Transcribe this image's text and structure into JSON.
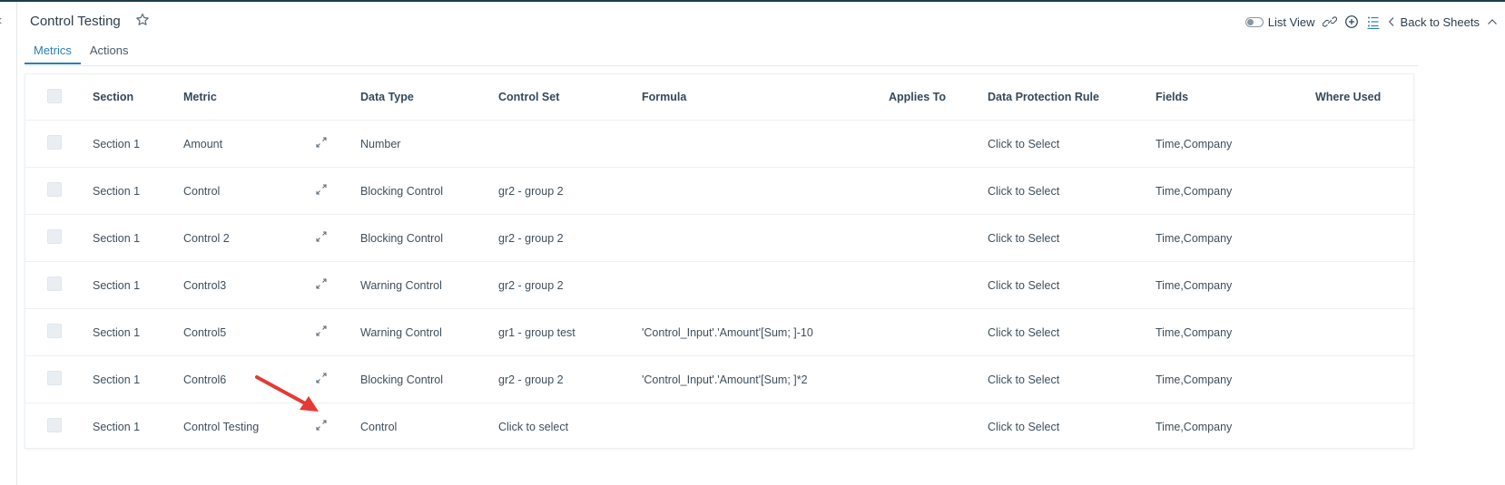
{
  "header": {
    "title": "Control Testing",
    "list_view_label": "List View",
    "back_label": "Back to Sheets"
  },
  "tabs": [
    {
      "label": "Metrics",
      "active": true
    },
    {
      "label": "Actions",
      "active": false
    }
  ],
  "table": {
    "columns": [
      "Section",
      "Metric",
      "",
      "Data Type",
      "Control Set",
      "Formula",
      "Applies To",
      "Data Protection Rule",
      "Fields",
      "Where Used"
    ],
    "rows": [
      {
        "section": "Section 1",
        "metric": "Amount",
        "data_type": "Number",
        "control_set": "",
        "formula": "",
        "applies_to": "",
        "dpr": "Click to Select",
        "fields": "Time,Company",
        "where_used": ""
      },
      {
        "section": "Section 1",
        "metric": "Control",
        "data_type": "Blocking Control",
        "control_set": "gr2 - group 2",
        "formula": "",
        "applies_to": "",
        "dpr": "Click to Select",
        "fields": "Time,Company",
        "where_used": ""
      },
      {
        "section": "Section 1",
        "metric": "Control 2",
        "data_type": "Blocking Control",
        "control_set": "gr2 - group 2",
        "formula": "",
        "applies_to": "",
        "dpr": "Click to Select",
        "fields": "Time,Company",
        "where_used": ""
      },
      {
        "section": "Section 1",
        "metric": "Control3",
        "data_type": "Warning Control",
        "control_set": "gr2 - group 2",
        "formula": "",
        "applies_to": "",
        "dpr": "Click to Select",
        "fields": "Time,Company",
        "where_used": ""
      },
      {
        "section": "Section 1",
        "metric": "Control5",
        "data_type": "Warning Control",
        "control_set": "gr1 - group test",
        "formula": "'Control_Input'.'Amount'[Sum; ]-10",
        "applies_to": "",
        "dpr": "Click to Select",
        "fields": "Time,Company",
        "where_used": ""
      },
      {
        "section": "Section 1",
        "metric": "Control6",
        "data_type": "Blocking Control",
        "control_set": "gr2 - group 2",
        "formula": "'Control_Input'.'Amount'[Sum; ]*2",
        "applies_to": "",
        "dpr": "Click to Select",
        "fields": "Time,Company",
        "where_used": ""
      },
      {
        "section": "Section 1",
        "metric": "Control Testing",
        "data_type": "Control",
        "control_set": "Click to select",
        "formula": "",
        "applies_to": "",
        "dpr": "Click to Select",
        "fields": "Time,Company",
        "where_used": ""
      }
    ]
  },
  "icons": {
    "star": "star-icon",
    "toggle": "toggle-icon",
    "link": "link-icon",
    "add": "add-circle-icon",
    "list": "list-icon",
    "chevron_left": "chevron-left-icon",
    "chevron_up": "chevron-up-icon",
    "expand": "expand-icon",
    "annotation": "red-arrow-annotation"
  },
  "colors": {
    "accent": "#2a7fb8",
    "annotation": "#e53935",
    "topbar": "#1f3b4d"
  }
}
